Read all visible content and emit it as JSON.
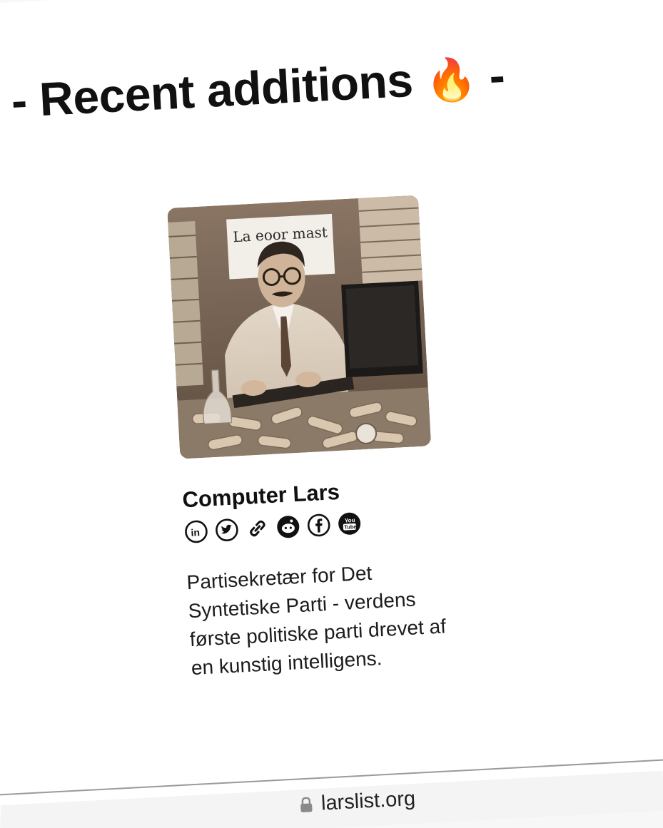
{
  "section": {
    "heading": "- Recent additions",
    "heading_emoji": "🔥",
    "heading_suffix": "-"
  },
  "profile": {
    "name": "Computer Lars",
    "photo_sign_text": "La eoor mast",
    "social_icons": [
      "linkedin-icon",
      "twitter-icon",
      "link-icon",
      "reddit-icon",
      "facebook-icon",
      "youtube-icon"
    ],
    "bio": "Partisekretær for Det Syntetiske Parti - verdens første politiske parti drevet af en kunstig intelligens."
  },
  "browser": {
    "url": "larslist.org",
    "lock_icon": "lock-icon"
  }
}
